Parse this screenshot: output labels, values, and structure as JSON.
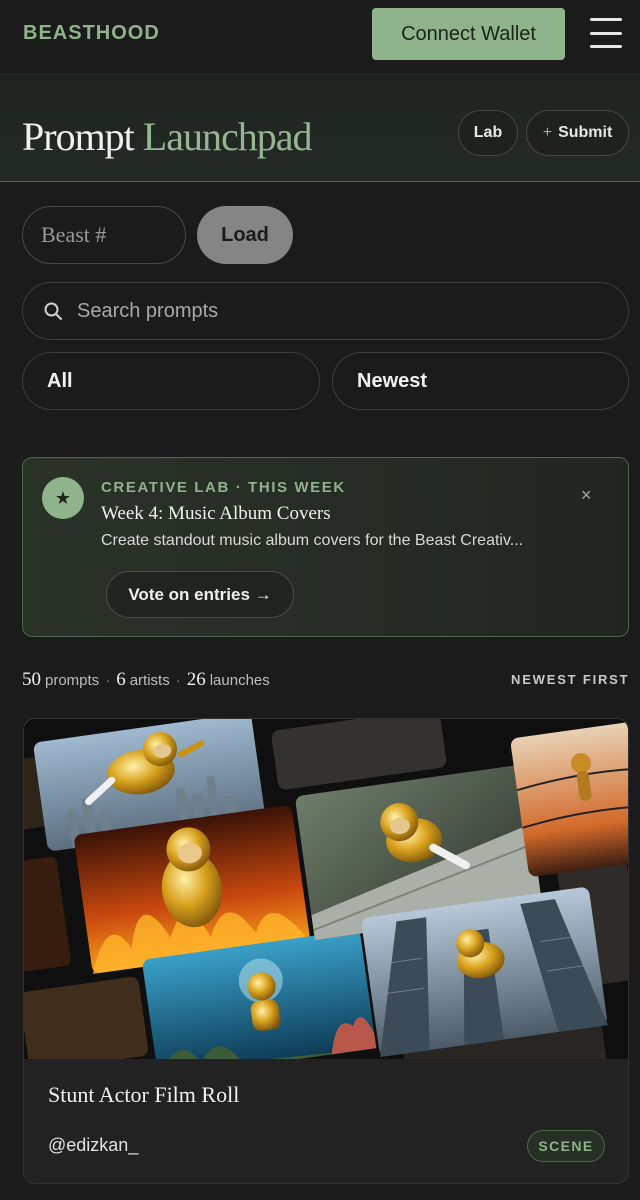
{
  "header": {
    "brand": "BEASTHOOD",
    "connect_label": "Connect Wallet",
    "menu_icon": "hamburger-icon"
  },
  "hero": {
    "title_word1": "Prompt",
    "title_word2": "Launchpad",
    "lab_label": "Lab",
    "submit_plus": "+",
    "submit_label": "Submit"
  },
  "beast": {
    "placeholder": "Beast #",
    "load_label": "Load"
  },
  "search": {
    "placeholder": "Search prompts",
    "icon": "search-icon"
  },
  "filters": {
    "category": "All",
    "sort": "Newest"
  },
  "creative_lab": {
    "icon": "star-icon",
    "star_glyph": "★",
    "kicker": "CREATIVE LAB · THIS WEEK",
    "week_title": "Week 4: Music Album Covers",
    "description": "Create standout music album covers for the Beast Creativ...",
    "close_glyph": "×",
    "vote_label": "Vote on entries →"
  },
  "stats": {
    "prompts_count": "50",
    "prompts_label": "prompts",
    "artists_count": "6",
    "artists_label": "artists",
    "launches_count": "26",
    "launches_label": "launches",
    "separator": "·",
    "sort_label": "NEWEST FIRST"
  },
  "cards": [
    {
      "title": "Stunt Actor Film Roll",
      "author": "@edizkan_",
      "tag": "SCENE"
    }
  ],
  "colors": {
    "accent": "#8fb38a",
    "background": "#1b1b1b",
    "card": "#222222"
  }
}
